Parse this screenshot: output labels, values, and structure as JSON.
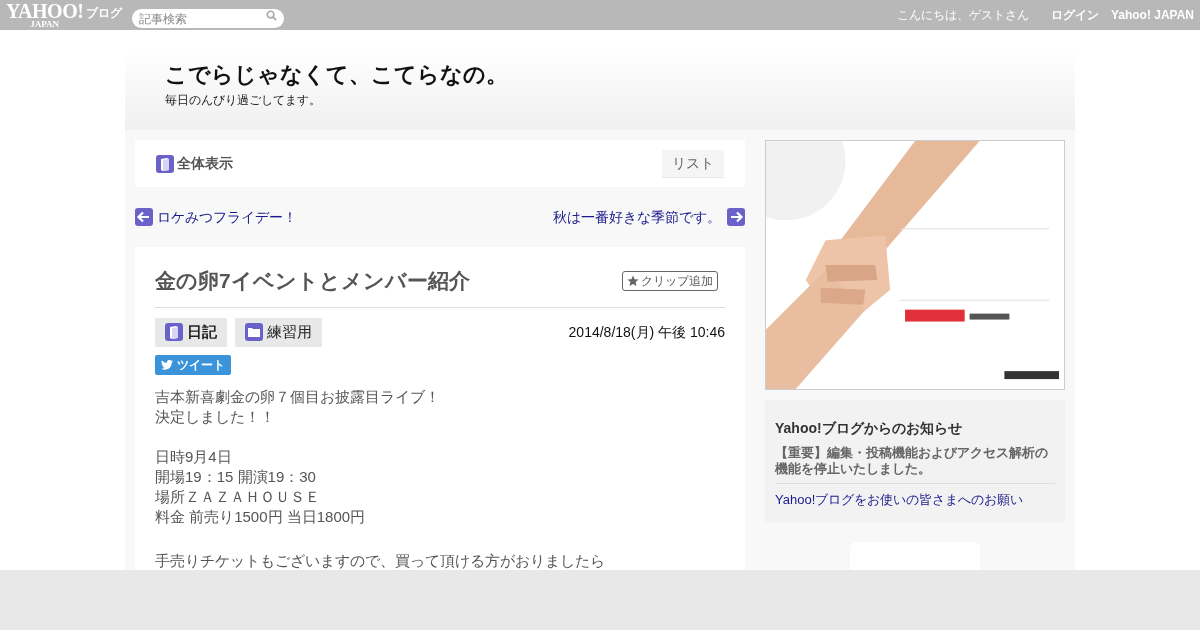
{
  "top_bar": {
    "logo": {
      "wordmark": "YAHOO!",
      "sub": "JAPAN",
      "service": "ブログ"
    },
    "search": {
      "placeholder": "記事検索"
    },
    "greeting": "こんにちは、ゲストさん",
    "links": [
      "ログイン",
      "Yahoo! JAPAN"
    ]
  },
  "blog": {
    "title": "こでらじゃなくて、こてらなの。",
    "subtitle": "毎日のんびり過ごしてます。"
  },
  "view_bar": {
    "label": "全体表示",
    "list_button": "リスト"
  },
  "nav": {
    "previous": "ロケみつフライデー！",
    "next": "秋は一番好きな季節です。"
  },
  "article": {
    "title": "金の卵7イベントとメンバー紹介",
    "clip_button": "クリップ追加",
    "tags": [
      {
        "kind": "book",
        "label": "日記"
      },
      {
        "kind": "folder",
        "label": "練習用"
      }
    ],
    "date": "2014/8/18(月) 午後 10:46",
    "tweet_button": "ツイート",
    "paragraphs": [
      [
        "吉本新喜劇金の卵７個目お披露目ライブ！",
        "決定しました！！"
      ],
      [
        "日時9月4日",
        "開場19：15 開演19：30",
        "場所ＺＡＺＡＨＯＵＳＥ",
        "料金 前売り1500円 当日1800円"
      ],
      [
        "手売りチケットもございますので、買って頂ける方がおりましたら"
      ]
    ]
  },
  "sidebar": {
    "notice": {
      "title": "Yahoo!ブログからのお知らせ",
      "important": "【重要】編集・投稿機能およびアクセス解析の機能を停止いたしました。",
      "link": "Yahoo!ブログをお使いの皆さまへのお願い"
    }
  }
}
